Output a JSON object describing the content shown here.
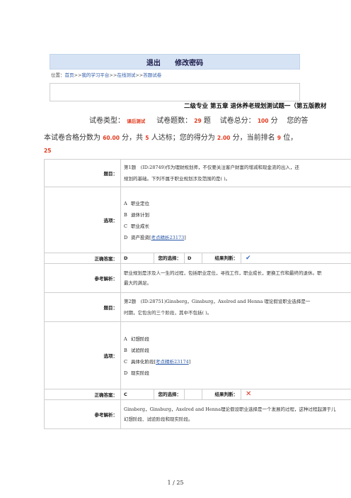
{
  "header": {
    "logout": "退出",
    "change_password": "修改密码"
  },
  "breadcrumb": {
    "prefix": "位置：",
    "home": "首页",
    "sep1": ">>",
    "platform": "我的学习平台",
    "sep2": ">>",
    "online_test": "在线测试",
    "sep3": ">>",
    "current": "答题试卷"
  },
  "paper": {
    "title": "二级专业 第五章 退休养老规划测试题一（第五版教材",
    "type_label": "试卷类型：",
    "type_value": "课后测试",
    "count_label": "试卷题数：",
    "count_value": "29",
    "count_unit": "题",
    "score_label": "试卷总分：",
    "score_value": "100",
    "score_unit": "分",
    "yours_label": "您的答",
    "pass_label": "本试卷合格分数为",
    "pass_value": "60.00",
    "pass_unit": "分，共",
    "people_value": "5",
    "people_unit": "人达标；您的得分为",
    "myscore_value": "2.00",
    "myscore_unit": "分，当前排名",
    "rank_value": "9",
    "rank_unit": "位，",
    "trail": "25"
  },
  "labels": {
    "question": "题目：",
    "options": "选项：",
    "correct": "正确答案：",
    "your_choice": "您的选择：",
    "result": "结果判断：",
    "analysis": "参考解析："
  },
  "questions": [
    {
      "text1": "第1题　(ID:28749)作为理财规划师，不仅要关注客户财富的增减和现金流的出入，还",
      "text2": "规划的基础。下列不属于职业规划涉及范围的是( )。",
      "options": [
        {
          "key": "A",
          "text": "职业定位"
        },
        {
          "key": "B",
          "text": "退休计划"
        },
        {
          "key": "C",
          "text": "职业成长"
        },
        {
          "key": "D",
          "text": "资产投资[",
          "kp": "考点精析23173",
          "end": "]"
        }
      ],
      "correct": "D",
      "choice": "D",
      "result": "correct",
      "analysis1": "职业规划是涉及人一生的过程，包括职业定位，寻找工作，职业成长，更换工作和最终的退休。职",
      "analysis2": "最大的满足。"
    },
    {
      "text1": "第2题　(ID:28751)Ginsberg，Ginsburg，Axelred and Henna 理论假设职业选择是一",
      "text2": "时期，它包含的三个阶段，其中不包括( )。",
      "options": [
        {
          "key": "A",
          "text": "幻想阶段"
        },
        {
          "key": "B",
          "text": "试验阶段"
        },
        {
          "key": "C",
          "text": "具体化阶段[",
          "kp": "考点精析23174",
          "end": "]"
        },
        {
          "key": "D",
          "text": "现实阶段"
        }
      ],
      "correct": "C",
      "choice": "",
      "result": "wrong",
      "analysis1": "Ginsberg，Ginsburg，Axelred and Henna理论假设职业选择是一个发展的过程，这种过程起源于儿",
      "analysis2": "幻想阶段、试验阶段和现实阶段。"
    }
  ],
  "footer": {
    "page": "1 / 25"
  },
  "colors": {
    "accent_red": "#e23b1f",
    "link_blue": "#2d5aa8",
    "topbar_bg": "#d6e3f4"
  }
}
